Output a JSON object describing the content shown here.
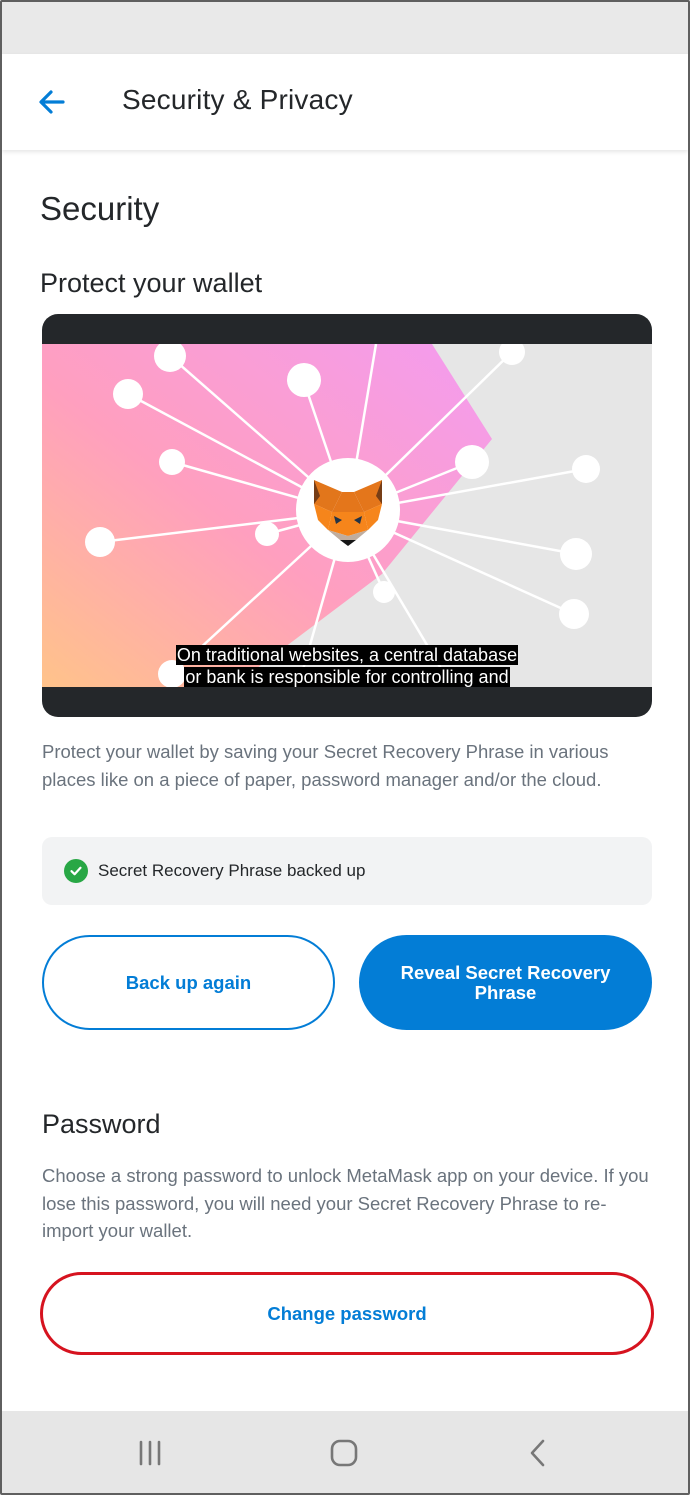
{
  "header": {
    "title": "Security & Privacy"
  },
  "security": {
    "heading": "Security",
    "protect_title": "Protect your wallet",
    "video_caption_line1": "On traditional websites, a central database",
    "video_caption_line2": "or bank is responsible for controlling and",
    "description": "Protect your wallet by saving your Secret Recovery Phrase in various places like on a piece of paper, password manager and/or the cloud.",
    "backup_status": "Secret Recovery Phrase backed up",
    "backup_again_label": "Back up again",
    "reveal_label": "Reveal Secret Recovery Phrase"
  },
  "password": {
    "heading": "Password",
    "description": "Choose a strong password to unlock MetaMask app on your device. If you lose this password, you will need your Secret Recovery Phrase to re-import your wallet.",
    "change_label": "Change password"
  },
  "icons": {
    "back": "arrow-left-icon",
    "backup_status": "check-circle-icon",
    "logo": "metamask-fox-icon",
    "nav_recent": "recent-apps-icon",
    "nav_home": "home-icon",
    "nav_back": "chevron-left-icon"
  },
  "colors": {
    "primary": "#037dd6",
    "success": "#28a745",
    "highlight_border": "#d6131f",
    "text": "#24272a",
    "muted_text": "#6a737d"
  }
}
